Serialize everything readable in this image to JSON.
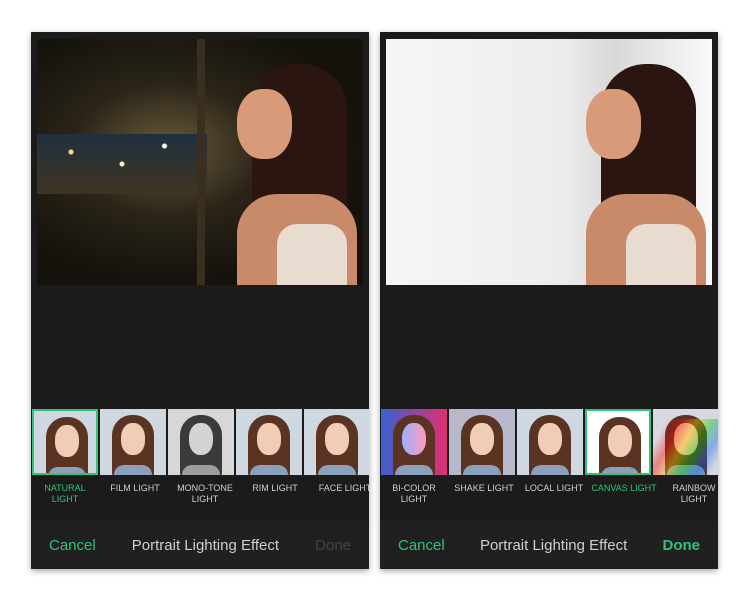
{
  "accent": "#2ec47a",
  "screens": [
    {
      "selected": 0,
      "effects": [
        {
          "label": "NATURAL LIGHT"
        },
        {
          "label": "FILM LIGHT"
        },
        {
          "label": "MONO-TONE LIGHT"
        },
        {
          "label": "RIM LIGHT"
        },
        {
          "label": "FACE LIGHT"
        }
      ],
      "cancel": "Cancel",
      "title": "Portrait Lighting Effect",
      "done": "Done",
      "done_enabled": false
    },
    {
      "selected": 3,
      "effects": [
        {
          "label": "BI-COLOR LIGHT"
        },
        {
          "label": "SHAKE LIGHT"
        },
        {
          "label": "LOCAL LIGHT"
        },
        {
          "label": "CANVAS LIGHT"
        },
        {
          "label": "RAINBOW LIGHT"
        }
      ],
      "cancel": "Cancel",
      "title": "Portrait Lighting Effect",
      "done": "Done",
      "done_enabled": true
    }
  ]
}
